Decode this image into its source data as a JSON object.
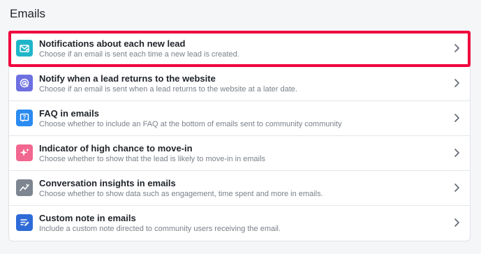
{
  "section": {
    "title": "Emails"
  },
  "items": [
    {
      "title": "Notifications about each new lead",
      "description": "Choose if an email is sent each time a new lead is created.",
      "icon": "email-notification-icon",
      "color": "#1fb5c9",
      "highlighted": true
    },
    {
      "title": "Notify when a lead returns to the website",
      "description": "Choose if an email is sent when a lead returns to the website at a later date.",
      "icon": "return-visit-icon",
      "color": "#6e6fe0",
      "highlighted": false
    },
    {
      "title": "FAQ in emails",
      "description": "Choose whether to include an FAQ at the bottom of emails sent to community community",
      "icon": "faq-icon",
      "color": "#2a8bf2",
      "highlighted": false
    },
    {
      "title": "Indicator of high chance to move-in",
      "description": "Choose whether to show that the lead is likely to move-in in emails",
      "icon": "sparkle-icon",
      "color": "#f2678f",
      "highlighted": false
    },
    {
      "title": "Conversation insights in emails",
      "description": "Choose whether to show data such as engagement, time spent and more in emails.",
      "icon": "insights-icon",
      "color": "#7d8591",
      "highlighted": false
    },
    {
      "title": "Custom note in emails",
      "description": "Include a custom note directed to community users receiving the email.",
      "icon": "note-icon",
      "color": "#2e6bd8",
      "highlighted": false
    }
  ],
  "colors": {
    "highlight_border": "#f0003c"
  }
}
